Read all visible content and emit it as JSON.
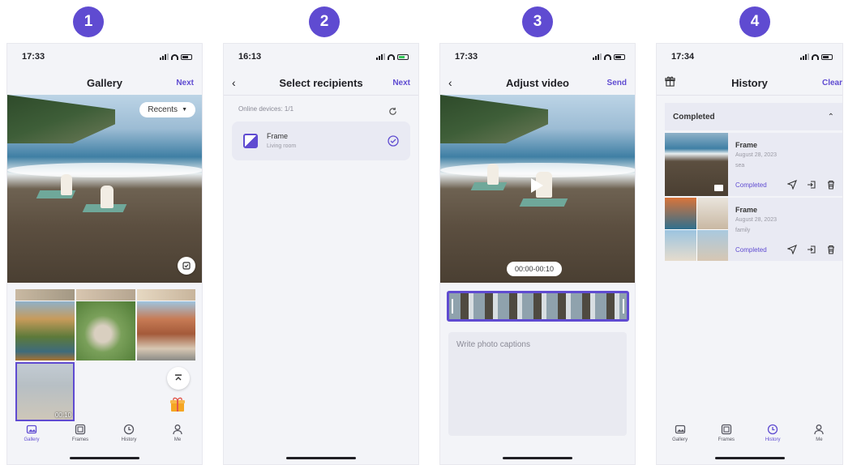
{
  "steps": [
    "1",
    "2",
    "3",
    "4"
  ],
  "accent": "#5f4bd1",
  "screen1": {
    "time": "17:33",
    "title": "Gallery",
    "next_label": "Next",
    "filter_label": "Recents",
    "video_duration": "00:10",
    "tabs": [
      {
        "label": "Gallery",
        "icon": "gallery-icon",
        "active": true
      },
      {
        "label": "Frames",
        "icon": "frames-icon",
        "active": false
      },
      {
        "label": "History",
        "icon": "history-icon",
        "active": false
      },
      {
        "label": "Me",
        "icon": "person-icon",
        "active": false
      }
    ]
  },
  "screen2": {
    "time": "16:13",
    "title": "Select recipients",
    "next_label": "Next",
    "online_devices": "Online devices: 1/1",
    "device": {
      "name": "Frame",
      "location": "Living room"
    }
  },
  "screen3": {
    "time": "17:33",
    "title": "Adjust video",
    "send_label": "Send",
    "time_range": "00:00-00:10",
    "caption_placeholder": "Write photo captions"
  },
  "screen4": {
    "time": "17:34",
    "title": "History",
    "clear_label": "Clear",
    "section_label": "Completed",
    "items": [
      {
        "title": "Frame",
        "date": "August 28, 2023",
        "caption": "sea",
        "status": "Completed"
      },
      {
        "title": "Frame",
        "date": "August 28, 2023",
        "caption": "family",
        "status": "Completed"
      }
    ],
    "tabs": [
      {
        "label": "Gallery",
        "icon": "gallery-icon",
        "active": false
      },
      {
        "label": "Frames",
        "icon": "frames-icon",
        "active": false
      },
      {
        "label": "History",
        "icon": "history-icon",
        "active": true
      },
      {
        "label": "Me",
        "icon": "person-icon",
        "active": false
      }
    ]
  }
}
